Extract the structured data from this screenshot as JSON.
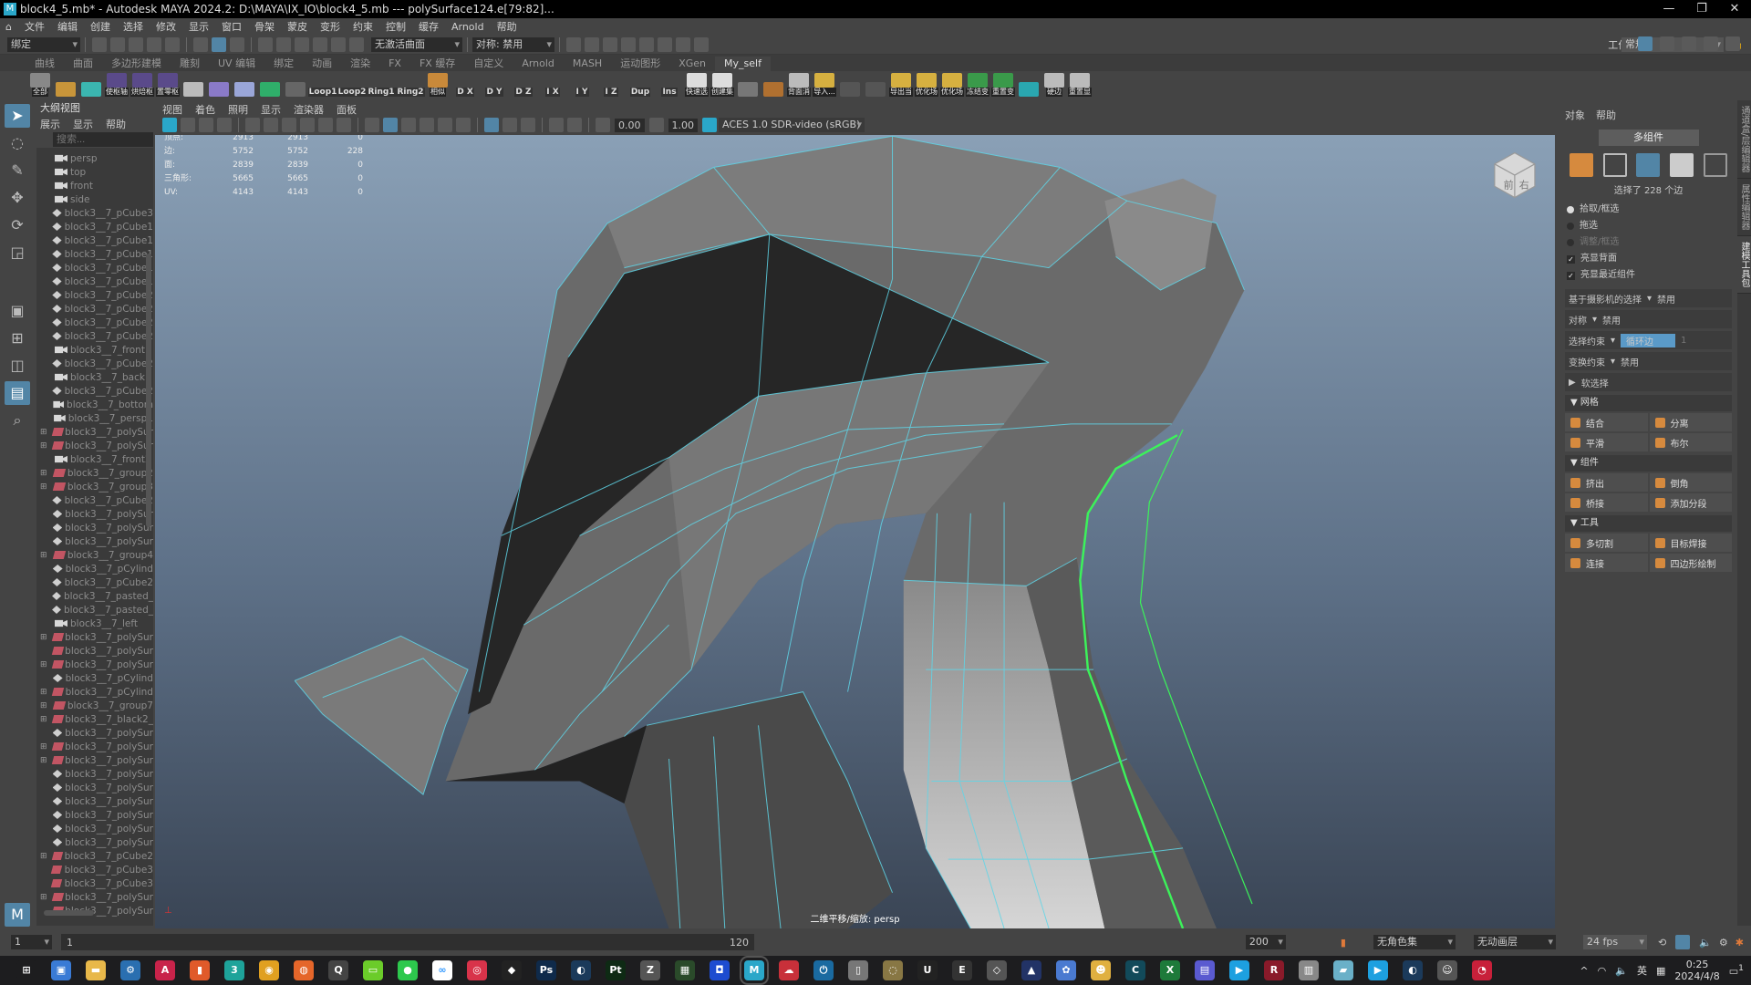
{
  "window": {
    "title": "block4_5.mb* - Autodesk MAYA 2024.2: D:\\MAYA\\IX_IO\\block4_5.mb   ---   polySurface124.e[79:82]...",
    "minimize": "—",
    "restore": "❐",
    "close": "✕"
  },
  "menu": [
    "文件",
    "编辑",
    "创建",
    "选择",
    "修改",
    "显示",
    "窗口",
    "骨架",
    "蒙皮",
    "变形",
    "约束",
    "控制",
    "缓存",
    "Arnold",
    "帮助"
  ],
  "status": {
    "menu_set": "绑定",
    "live_surface": "无激活曲面",
    "symmetry": "对称: 禁用",
    "workspace_label": "工作区:",
    "workspace": "常规*"
  },
  "shelf_tabs": [
    {
      "label": "曲线"
    },
    {
      "label": "曲面"
    },
    {
      "label": "多边形建模"
    },
    {
      "label": "雕刻"
    },
    {
      "label": "UV 编辑"
    },
    {
      "label": "绑定"
    },
    {
      "label": "动画"
    },
    {
      "label": "渲染"
    },
    {
      "label": "FX"
    },
    {
      "label": "FX 缓存"
    },
    {
      "label": "自定义"
    },
    {
      "label": "Arnold"
    },
    {
      "label": "MASH"
    },
    {
      "label": "运动图形"
    },
    {
      "label": "XGen"
    },
    {
      "label": "My_self",
      "active": true
    }
  ],
  "shelf": [
    {
      "label": "全部",
      "color": "#888"
    },
    {
      "label": "",
      "color": "#c8953a"
    },
    {
      "label": "",
      "color": "#3bb6b0"
    },
    {
      "label": "使枢轴",
      "color": "#5a4a8a"
    },
    {
      "label": "烘焙枢",
      "color": "#5a4a8a"
    },
    {
      "label": "置零枢",
      "color": "#5a4a8a"
    },
    {
      "label": "",
      "color": "#bbb"
    },
    {
      "label": "",
      "color": "#8a7ac8"
    },
    {
      "label": "",
      "color": "#9aa6d8"
    },
    {
      "label": "",
      "color": "#2fae6a"
    },
    {
      "label": "",
      "color": "#666"
    },
    {
      "label": "Loop1",
      "text": true
    },
    {
      "label": "Loop2",
      "text": true
    },
    {
      "label": "Ring1",
      "text": true
    },
    {
      "label": "Ring2",
      "text": true
    },
    {
      "label": "相似",
      "color": "#c8893a"
    },
    {
      "label": "D X",
      "text": true
    },
    {
      "label": "D Y",
      "text": true
    },
    {
      "label": "D Z",
      "text": true
    },
    {
      "label": "I X",
      "text": true
    },
    {
      "label": "I Y",
      "text": true
    },
    {
      "label": "I Z",
      "text": true
    },
    {
      "label": "Dup",
      "text": true
    },
    {
      "label": "Ins",
      "text": true
    },
    {
      "label": "快速选",
      "color": "#ddd"
    },
    {
      "label": "创建集",
      "color": "#ddd"
    },
    {
      "label": "",
      "color": "#777"
    },
    {
      "label": "",
      "color": "#b07030"
    },
    {
      "label": "背面消",
      "color": "#bbb"
    },
    {
      "label": "导入...",
      "color": "#d6b040"
    },
    {
      "label": "",
      "color": "#555"
    },
    {
      "label": "",
      "color": "#555"
    },
    {
      "label": "导出当",
      "color": "#d6b040"
    },
    {
      "label": "优化场",
      "color": "#d6b040"
    },
    {
      "label": "优化场",
      "color": "#d6b040"
    },
    {
      "label": "冻结变",
      "color": "#3a9a4a"
    },
    {
      "label": "重置变",
      "color": "#3a9a4a"
    },
    {
      "label": "",
      "color": "#2aa7b0"
    },
    {
      "label": "硬边",
      "color": "#bbb"
    },
    {
      "label": "重置显",
      "color": "#bbb"
    }
  ],
  "outliner": {
    "title": "大纲视图",
    "menu": [
      "展示",
      "显示",
      "帮助"
    ],
    "search_placeholder": "搜索...",
    "items": [
      {
        "label": "persp",
        "icon": "camera"
      },
      {
        "label": "top",
        "icon": "camera"
      },
      {
        "label": "front",
        "icon": "camera"
      },
      {
        "label": "side",
        "icon": "camera"
      },
      {
        "label": "block3__7_pCube3",
        "icon": "mesh"
      },
      {
        "label": "block3__7_pCube1",
        "icon": "mesh"
      },
      {
        "label": "block3__7_pCube1",
        "icon": "mesh"
      },
      {
        "label": "block3__7_pCube1",
        "icon": "mesh"
      },
      {
        "label": "block3__7_pCube1",
        "icon": "mesh"
      },
      {
        "label": "block3__7_pCube1",
        "icon": "mesh"
      },
      {
        "label": "block3__7_pCube2",
        "icon": "mesh"
      },
      {
        "label": "block3__7_pCube2",
        "icon": "mesh"
      },
      {
        "label": "block3__7_pCube2",
        "icon": "mesh"
      },
      {
        "label": "block3__7_pCube2",
        "icon": "mesh"
      },
      {
        "label": "block3__7_front1",
        "icon": "camera"
      },
      {
        "label": "block3__7_pCube2",
        "icon": "mesh"
      },
      {
        "label": "block3__7_back",
        "icon": "camera"
      },
      {
        "label": "block3__7_pCube2",
        "icon": "mesh"
      },
      {
        "label": "block3__7_bottom",
        "icon": "camera"
      },
      {
        "label": "block3__7_persp1",
        "icon": "camera"
      },
      {
        "label": "block3__7_polySur",
        "icon": "group",
        "expand": true
      },
      {
        "label": "block3__7_polySur",
        "icon": "group",
        "expand": true
      },
      {
        "label": "block3__7_front2",
        "icon": "camera"
      },
      {
        "label": "block3__7_group2",
        "icon": "group",
        "expand": true
      },
      {
        "label": "block3__7_group3",
        "icon": "group",
        "expand": true
      },
      {
        "label": "block3__7_pCube2",
        "icon": "mesh"
      },
      {
        "label": "block3__7_polySur",
        "icon": "mesh"
      },
      {
        "label": "block3__7_polySur",
        "icon": "mesh"
      },
      {
        "label": "block3__7_polySur",
        "icon": "mesh"
      },
      {
        "label": "block3__7_group4",
        "icon": "group",
        "expand": true
      },
      {
        "label": "block3__7_pCylind",
        "icon": "mesh"
      },
      {
        "label": "block3__7_pCube2",
        "icon": "mesh"
      },
      {
        "label": "block3__7_pasted_",
        "icon": "mesh"
      },
      {
        "label": "block3__7_pasted_",
        "icon": "mesh"
      },
      {
        "label": "block3__7_left",
        "icon": "camera"
      },
      {
        "label": "block3__7_polySur",
        "icon": "group",
        "expand": true
      },
      {
        "label": "block3__7_polySur",
        "icon": "group"
      },
      {
        "label": "block3__7_polySur",
        "icon": "group",
        "expand": true
      },
      {
        "label": "block3__7_pCylind",
        "icon": "mesh"
      },
      {
        "label": "block3__7_pCylind",
        "icon": "group",
        "expand": true
      },
      {
        "label": "block3__7_group7",
        "icon": "group",
        "expand": true
      },
      {
        "label": "block3__7_black2_",
        "icon": "group",
        "expand": true
      },
      {
        "label": "block3__7_polySur",
        "icon": "mesh"
      },
      {
        "label": "block3__7_polySur",
        "icon": "group",
        "expand": true
      },
      {
        "label": "block3__7_polySur",
        "icon": "group",
        "expand": true
      },
      {
        "label": "block3__7_polySur",
        "icon": "mesh"
      },
      {
        "label": "block3__7_polySur",
        "icon": "mesh"
      },
      {
        "label": "block3__7_polySur",
        "icon": "mesh"
      },
      {
        "label": "block3__7_polySur",
        "icon": "mesh"
      },
      {
        "label": "block3__7_polySur",
        "icon": "mesh"
      },
      {
        "label": "block3__7_polySur",
        "icon": "mesh"
      },
      {
        "label": "block3__7_pCube2",
        "icon": "group",
        "expand": true
      },
      {
        "label": "block3__7_pCube3",
        "icon": "group"
      },
      {
        "label": "block3__7_pCube3",
        "icon": "group"
      },
      {
        "label": "block3__7_polySur",
        "icon": "group",
        "expand": true
      },
      {
        "label": "block3__7_polySur",
        "icon": "group"
      }
    ]
  },
  "viewport": {
    "menu": [
      "视图",
      "着色",
      "照明",
      "显示",
      "渲染器",
      "面板"
    ],
    "exposure": "0.00",
    "gamma": "1.00",
    "color_space": "ACES 1.0 SDR-video (sRGB)",
    "camera_label": "二维平移/缩放: persp",
    "hud": [
      {
        "label": "顶点:",
        "a": "2913",
        "b": "2913",
        "c": "0"
      },
      {
        "label": "边:",
        "a": "5752",
        "b": "5752",
        "c": "228"
      },
      {
        "label": "面:",
        "a": "2839",
        "b": "2839",
        "c": "0"
      },
      {
        "label": "三角形:",
        "a": "5665",
        "b": "5665",
        "c": "0"
      },
      {
        "label": "UV:",
        "a": "4143",
        "b": "4143",
        "c": "0"
      }
    ],
    "viewcube": {
      "front": "前",
      "right": "右"
    },
    "colors": {
      "wire": "#5fd6e8",
      "selected_edge": "#3cf25a"
    }
  },
  "modeling_toolkit": {
    "menu": [
      "对象",
      "帮助"
    ],
    "multi_component": "多组件",
    "selection_info": "选择了 228 个边",
    "modes": [
      {
        "label": "拾取/框选",
        "on": true
      },
      {
        "label": "拖选"
      },
      {
        "label": "调整/框选"
      }
    ],
    "checks": [
      "亮显背面",
      "亮显最近组件"
    ],
    "camera_select": {
      "label": "基于摄影机的选择",
      "value": "禁用"
    },
    "symmetry": {
      "label": "对称",
      "value": "禁用"
    },
    "select_constraint": {
      "label": "选择约束",
      "value": "循环边",
      "extra": "1"
    },
    "transform_constraint": {
      "label": "变换约束",
      "value": "禁用"
    },
    "soft_select": "软选择",
    "sections": [
      {
        "title": "网格",
        "buttons": [
          "结合",
          "分离",
          "平滑",
          "布尔"
        ]
      },
      {
        "title": "组件",
        "buttons": [
          "挤出",
          "倒角",
          "桥接",
          "添加分段"
        ]
      },
      {
        "title": "工具",
        "buttons": [
          "多切割",
          "目标焊接",
          "连接",
          "四边形绘制"
        ]
      }
    ]
  },
  "side_tabs": [
    {
      "label": "通道盒/层编辑器"
    },
    {
      "label": "属性编辑器"
    },
    {
      "label": "建模工具包",
      "active": true
    }
  ],
  "timeline": {
    "start": "1",
    "range_start": "1",
    "range_end": "120",
    "end": "200",
    "character_set": "无角色集",
    "anim_layer": "无动画层",
    "fps": "24 fps"
  },
  "taskbar": {
    "apps": [
      {
        "name": "start",
        "glyph": "⊞",
        "color": "#1d1d1f"
      },
      {
        "name": "this-pc",
        "glyph": "▣",
        "color": "#3a7bd5"
      },
      {
        "name": "file-explorer",
        "glyph": "▬",
        "color": "#e8b84a"
      },
      {
        "name": "settings",
        "glyph": "⚙",
        "color": "#2a6fb0"
      },
      {
        "name": "autocad",
        "glyph": "A",
        "color": "#c8234a"
      },
      {
        "name": "colored-app",
        "glyph": "▮",
        "color": "#e05a2a"
      },
      {
        "name": "3ds-max",
        "glyph": "3",
        "color": "#1ea39a"
      },
      {
        "name": "chrome",
        "glyph": "◉",
        "color": "#e0a020"
      },
      {
        "name": "firefox",
        "glyph": "◍",
        "color": "#e5662a"
      },
      {
        "name": "q-app",
        "glyph": "Q",
        "color": "#444"
      },
      {
        "name": "green-app",
        "glyph": "▭",
        "color": "#6bcc2a"
      },
      {
        "name": "wechat",
        "glyph": "●",
        "color": "#2dc84d"
      },
      {
        "name": "baidu-netdisk",
        "glyph": "∞",
        "color": "#fff"
      },
      {
        "name": "netease-music",
        "glyph": "◎",
        "color": "#d8334a"
      },
      {
        "name": "qq",
        "glyph": "◆",
        "color": "#222"
      },
      {
        "name": "photoshop",
        "glyph": "Ps",
        "color": "#0f2a4a"
      },
      {
        "name": "steam",
        "glyph": "◐",
        "color": "#1b3a5a"
      },
      {
        "name": "substance-painter",
        "glyph": "Pt",
        "color": "#0e2a14"
      },
      {
        "name": "zbrush",
        "glyph": "Z",
        "color": "#555"
      },
      {
        "name": "grid-app",
        "glyph": "▦",
        "color": "#2a4a2a"
      },
      {
        "name": "blue-app",
        "glyph": "◘",
        "color": "#1d4cd0"
      },
      {
        "name": "maya",
        "glyph": "M",
        "color": "#2aa7c9",
        "active": true
      },
      {
        "name": "cloud-app",
        "glyph": "☁",
        "color": "#c8303a"
      },
      {
        "name": "power-app",
        "glyph": "⏻",
        "color": "#1a6aa0"
      },
      {
        "name": "gray-app",
        "glyph": "▯",
        "color": "#777"
      },
      {
        "name": "globe-app",
        "glyph": "◌",
        "color": "#887744"
      },
      {
        "name": "unreal",
        "glyph": "U",
        "color": "#222"
      },
      {
        "name": "epic-games",
        "glyph": "E",
        "color": "#333"
      },
      {
        "name": "unity",
        "glyph": "◇",
        "color": "#555"
      },
      {
        "name": "cat-app",
        "glyph": "▲",
        "color": "#223366"
      },
      {
        "name": "flower-app",
        "glyph": "✿",
        "color": "#4a7ad0"
      },
      {
        "name": "doge-app",
        "glyph": "☻",
        "color": "#e0b040"
      },
      {
        "name": "c-app",
        "glyph": "C",
        "color": "#124a5a"
      },
      {
        "name": "excel",
        "glyph": "X",
        "color": "#1d7a3a"
      },
      {
        "name": "purple-app",
        "glyph": "▤",
        "color": "#5a5ad0"
      },
      {
        "name": "video-app",
        "glyph": "▶",
        "color": "#1da0e0"
      },
      {
        "name": "r-app",
        "glyph": "R",
        "color": "#8a1a2a"
      },
      {
        "name": "box-app",
        "glyph": "▥",
        "color": "#888"
      },
      {
        "name": "glass-app",
        "glyph": "▰",
        "color": "#6ab0c8"
      },
      {
        "name": "video-app-2",
        "glyph": "▶",
        "color": "#1da0e0"
      },
      {
        "name": "steam-2",
        "glyph": "◐",
        "color": "#1b3a5a"
      },
      {
        "name": "face-app",
        "glyph": "☺",
        "color": "#555"
      },
      {
        "name": "recorder",
        "glyph": "◔",
        "color": "#c8203a"
      }
    ],
    "ime": "英",
    "time": "0:25",
    "date": "2024/4/8",
    "notification_count": "1"
  }
}
